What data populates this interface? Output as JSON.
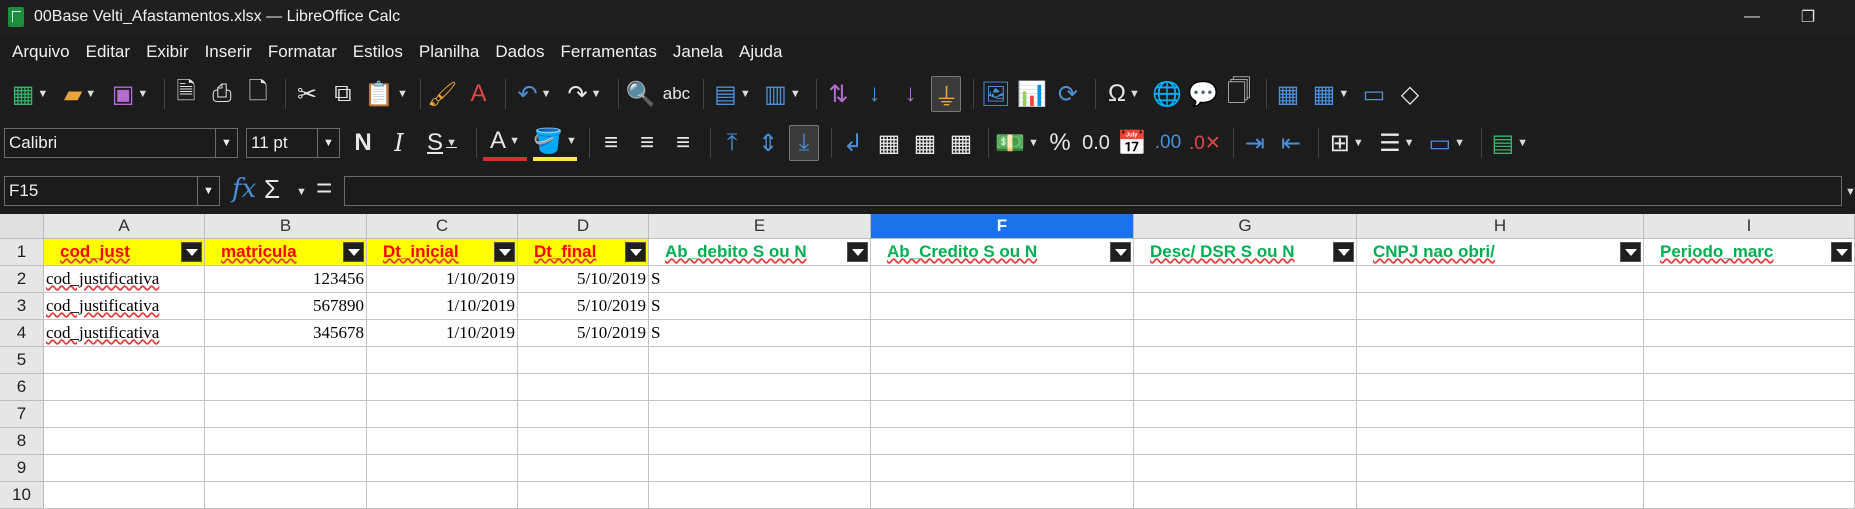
{
  "window": {
    "title": "00Base Velti_Afastamentos.xlsx — LibreOffice Calc",
    "minimize": "—",
    "restore": "❐"
  },
  "menu": [
    "Arquivo",
    "Editar",
    "Exibir",
    "Inserir",
    "Formatar",
    "Estilos",
    "Planilha",
    "Dados",
    "Ferramentas",
    "Janela",
    "Ajuda"
  ],
  "formatting": {
    "font_name": "Calibri",
    "font_size": "11 pt"
  },
  "formula_bar": {
    "cell_ref": "F15",
    "fx": "fx",
    "sigma": "Σ",
    "equals": "=",
    "content": ""
  },
  "sheet": {
    "active_column": "F",
    "columns": [
      {
        "label": "A"
      },
      {
        "label": "B"
      },
      {
        "label": "C"
      },
      {
        "label": "D"
      },
      {
        "label": "E"
      },
      {
        "label": "F"
      },
      {
        "label": "G"
      },
      {
        "label": "H"
      },
      {
        "label": "I"
      }
    ],
    "rows": [
      "1",
      "2",
      "3",
      "4",
      "5",
      "6",
      "7",
      "8",
      "9",
      "10"
    ],
    "header_row": [
      {
        "text": "cod_just",
        "style": "yellow"
      },
      {
        "text": "matricula",
        "style": "yellow"
      },
      {
        "text": "Dt_inicial",
        "style": "yellow"
      },
      {
        "text": "Dt_final",
        "style": "yellow"
      },
      {
        "text": "Ab_debito S ou N",
        "style": "green"
      },
      {
        "text": "Ab_Credito S ou N",
        "style": "green"
      },
      {
        "text": "Desc/ DSR S ou N",
        "style": "green"
      },
      {
        "text": "CNPJ nao obri/",
        "style": "green"
      },
      {
        "text": "Periodo_marc",
        "style": "green"
      }
    ],
    "data_rows": [
      [
        "cod_justificativa",
        "123456",
        "1/10/2019",
        "5/10/2019",
        "S"
      ],
      [
        "cod_justificativa",
        "567890",
        "1/10/2019",
        "5/10/2019",
        "S"
      ],
      [
        "cod_justificativa",
        "345678",
        "1/10/2019",
        "5/10/2019",
        "S"
      ]
    ]
  },
  "colors": {
    "header_yellow": "#ffff00",
    "header_red_text": "#ff0000",
    "header_green_text": "#00b050",
    "active_column": "#1a73e8"
  }
}
